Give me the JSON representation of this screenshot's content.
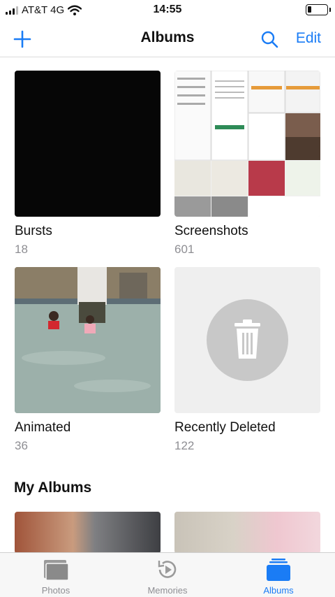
{
  "status_bar": {
    "carrier": "AT&T 4G",
    "time": "14:55",
    "battery_level": 0.2
  },
  "nav": {
    "title": "Albums",
    "edit_label": "Edit"
  },
  "albums": [
    {
      "name": "Bursts",
      "count": "18"
    },
    {
      "name": "Screenshots",
      "count": "601"
    },
    {
      "name": "Animated",
      "count": "36"
    },
    {
      "name": "Recently Deleted",
      "count": "122"
    }
  ],
  "my_albums": {
    "title": "My Albums"
  },
  "tabs": [
    {
      "label": "Photos",
      "icon": "photos-icon",
      "active": false
    },
    {
      "label": "Memories",
      "icon": "memories-icon",
      "active": false
    },
    {
      "label": "Albums",
      "icon": "albums-icon",
      "active": true
    }
  ],
  "colors": {
    "accent": "#1a7cf5",
    "secondary_text": "#8e8e93"
  }
}
